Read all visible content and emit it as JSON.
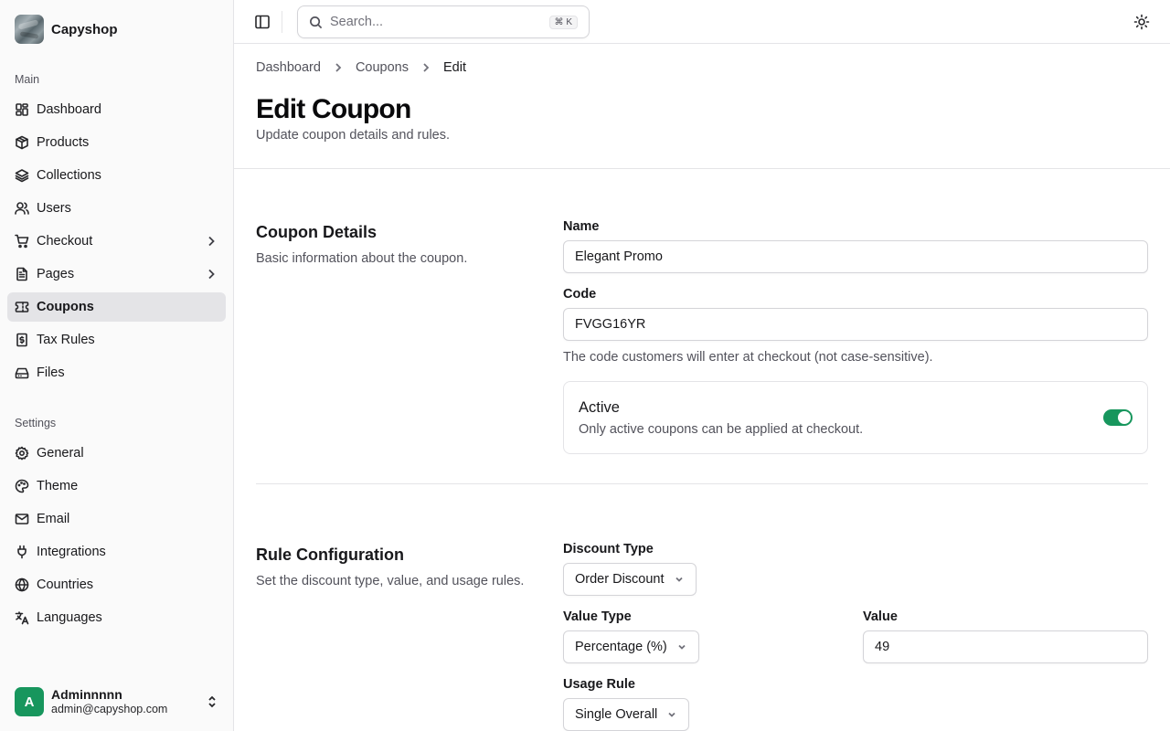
{
  "brand": {
    "name": "Capyshop"
  },
  "sidebar": {
    "main_label": "Main",
    "main_items": [
      {
        "label": "Dashboard",
        "icon": "dashboard-icon"
      },
      {
        "label": "Products",
        "icon": "package-icon"
      },
      {
        "label": "Collections",
        "icon": "layers-icon"
      },
      {
        "label": "Users",
        "icon": "users-icon"
      },
      {
        "label": "Checkout",
        "icon": "cart-icon",
        "has_children": true
      },
      {
        "label": "Pages",
        "icon": "file-icon",
        "has_children": true
      },
      {
        "label": "Coupons",
        "icon": "ticket-icon",
        "active": true
      },
      {
        "label": "Tax Rules",
        "icon": "receipt-icon"
      },
      {
        "label": "Files",
        "icon": "hard-drive-icon"
      }
    ],
    "settings_label": "Settings",
    "settings_items": [
      {
        "label": "General",
        "icon": "gear-icon"
      },
      {
        "label": "Theme",
        "icon": "palette-icon"
      },
      {
        "label": "Email",
        "icon": "mail-icon"
      },
      {
        "label": "Integrations",
        "icon": "plug-icon"
      },
      {
        "label": "Countries",
        "icon": "globe-icon"
      },
      {
        "label": "Languages",
        "icon": "translate-icon"
      }
    ],
    "user": {
      "initial": "A",
      "name": "Adminnnnn",
      "email": "admin@capyshop.com"
    }
  },
  "topbar": {
    "search_placeholder": "Search...",
    "search_shortcut": "⌘ K"
  },
  "breadcrumb": {
    "items": [
      "Dashboard",
      "Coupons"
    ],
    "current": "Edit"
  },
  "page": {
    "title": "Edit Coupon",
    "subtitle": "Update coupon details and rules."
  },
  "coupon_details": {
    "title": "Coupon Details",
    "description": "Basic information about the coupon.",
    "name_label": "Name",
    "name_value": "Elegant Promo",
    "code_label": "Code",
    "code_value": "FVGG16YR",
    "code_hint": "The code customers will enter at checkout (not case-sensitive).",
    "active_title": "Active",
    "active_description": "Only active coupons can be applied at checkout.",
    "active": true
  },
  "rule_config": {
    "title": "Rule Configuration",
    "description": "Set the discount type, value, and usage rules.",
    "discount_type_label": "Discount Type",
    "discount_type_value": "Order Discount",
    "value_type_label": "Value Type",
    "value_type_value": "Percentage (%)",
    "value_label": "Value",
    "value_value": "49",
    "usage_rule_label": "Usage Rule",
    "usage_rule_value": "Single Overall"
  },
  "colors": {
    "accent": "#17965d",
    "active_bg": "#e4e4e7"
  }
}
